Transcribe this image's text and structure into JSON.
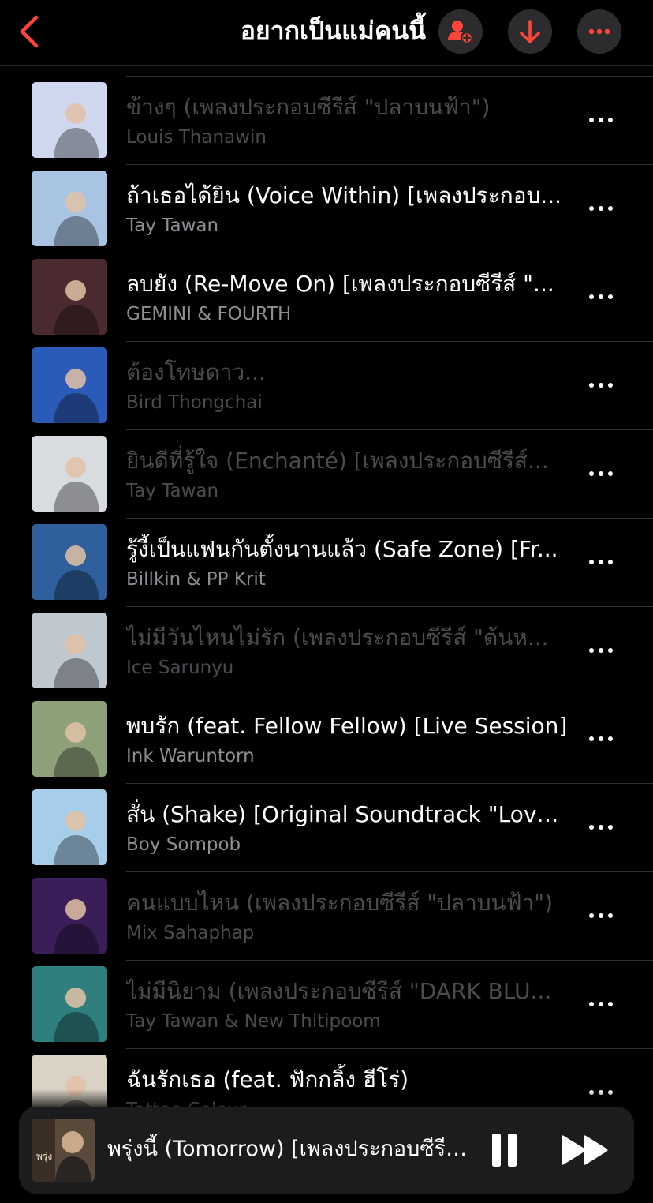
{
  "header": {
    "title": "อยากเป็นแม่คนนี้",
    "back_icon": "chevron-left-icon",
    "actions": [
      "add-person-icon",
      "download-icon",
      "more-icon"
    ],
    "accent": "#ff453a"
  },
  "songs": [
    {
      "title": "ข้างๆ (เพลงประกอบซีรีส์ \"ปลาบนฟ้า\")",
      "artist": "Louis Thanawin",
      "dimmed": true,
      "art_color": "#cfd8ee"
    },
    {
      "title": "ถ้าเธอได้ยิน (Voice Within) [เพลงประกอบ...",
      "artist": "Tay Tawan",
      "dimmed": false,
      "art_color": "#a9c4e2"
    },
    {
      "title": "ลบยัง (Re-Move On) [เพลงประกอบซีรีส์ \"...",
      "artist": "GEMINI & FOURTH",
      "dimmed": false,
      "art_color": "#4a2a2e"
    },
    {
      "title": "ต้องโทษดาว...",
      "artist": "Bird Thongchai",
      "dimmed": true,
      "art_color": "#2b5bb8"
    },
    {
      "title": "ยินดีที่รู้ใจ (Enchanté) [เพลงประกอบซีรีส์...",
      "artist": "Tay Tawan",
      "dimmed": true,
      "art_color": "#d8dbe0"
    },
    {
      "title": "รู้งี้เป็นแฟนกันตั้งนานแล้ว (Safe Zone) [Fr...",
      "artist": "Billkin & PP Krit",
      "dimmed": false,
      "art_color": "#2f5f9c"
    },
    {
      "title": "ไม่มีวันไหนไม่รัก (เพลงประกอบซีรีส์ \"ต้นห...",
      "artist": "Ice Sarunyu",
      "dimmed": true,
      "art_color": "#bfc8cf"
    },
    {
      "title": "พบรัก (feat. Fellow Fellow) [Live Session]",
      "artist": "Ink Waruntorn",
      "dimmed": false,
      "art_color": "#8ea07a"
    },
    {
      "title": "สั่น (Shake) [Original Soundtrack \"Love...",
      "artist": "Boy Sompob",
      "dimmed": false,
      "art_color": "#a6cdea"
    },
    {
      "title": "คนแบบไหน (เพลงประกอบซีรีส์ \"ปลาบนฟ้า\")",
      "artist": "Mix Sahaphap",
      "dimmed": true,
      "art_color": "#3a1e5a"
    },
    {
      "title": "ไม่มีนิยาม (เพลงประกอบซีรีส์ \"DARK BLU...",
      "artist": "Tay Tawan & New Thitipoom",
      "dimmed": true,
      "art_color": "#2f7f7f"
    },
    {
      "title": "ฉันรักเธอ (feat. ฟักกลิ้ง ฮีโร่)",
      "artist": "Tattoo Colour",
      "dimmed": false,
      "art_color": "#d9d2c5"
    }
  ],
  "now_playing": {
    "title": "พรุ่งนี้ (Tomorrow) [เพลงประกอบซีรีส์...",
    "art_color": "#5a4a3c",
    "pause_icon": "pause-icon",
    "next_icon": "fast-forward-icon"
  }
}
